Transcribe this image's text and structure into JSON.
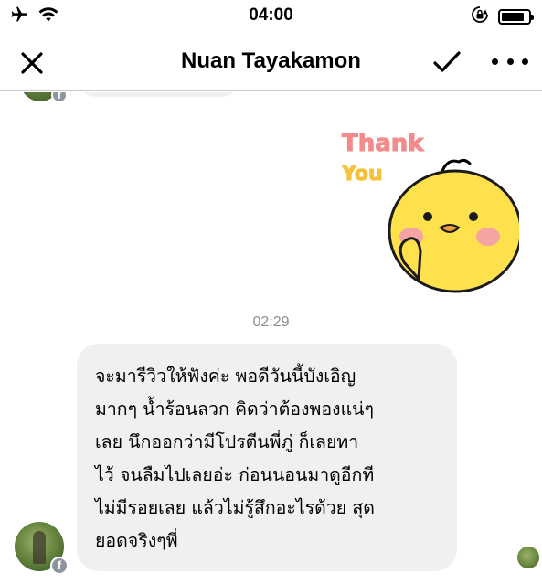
{
  "status_bar": {
    "time": "04:00",
    "battery_level": 0.85,
    "icons": [
      "airplane-icon",
      "wifi-icon",
      "orientation-lock-icon",
      "battery-icon"
    ]
  },
  "nav": {
    "title": "Nuan Tayakamon",
    "icons": [
      "close-icon",
      "checkmark-icon",
      "more-icon"
    ]
  },
  "conversation": {
    "sticker": {
      "text_line1": "Thank",
      "text_line2": "You",
      "colors": {
        "thank": "#f28b8b",
        "you": "#f6c23c",
        "chick": "#ffe04d",
        "cheek": "#f5a3a3"
      }
    },
    "timestamp": "02:29",
    "message": {
      "text": "จะมารีวิวให้ฟังค่ะ พอดีวันนี้บังเอิญ\nมากๆ น้ำร้อนลวก คิดว่าต้องพองแน่ๆ\nเลย นึกออกว่ามีโปรตีนพี่ภู่ ก็เลยทา\nไว้ จนลืมไปเลยอ่ะ ก่อนนอนมาดูอีกที\nไม่มีรอยเลย แล้วไม่รู้สึกอะไรด้วย สุด\nยอดจริงๆพี่"
    },
    "colors": {
      "bubble": "#f1f0f0",
      "timestamp": "#8a8d91",
      "facebook_badge": "#8d949e"
    }
  }
}
